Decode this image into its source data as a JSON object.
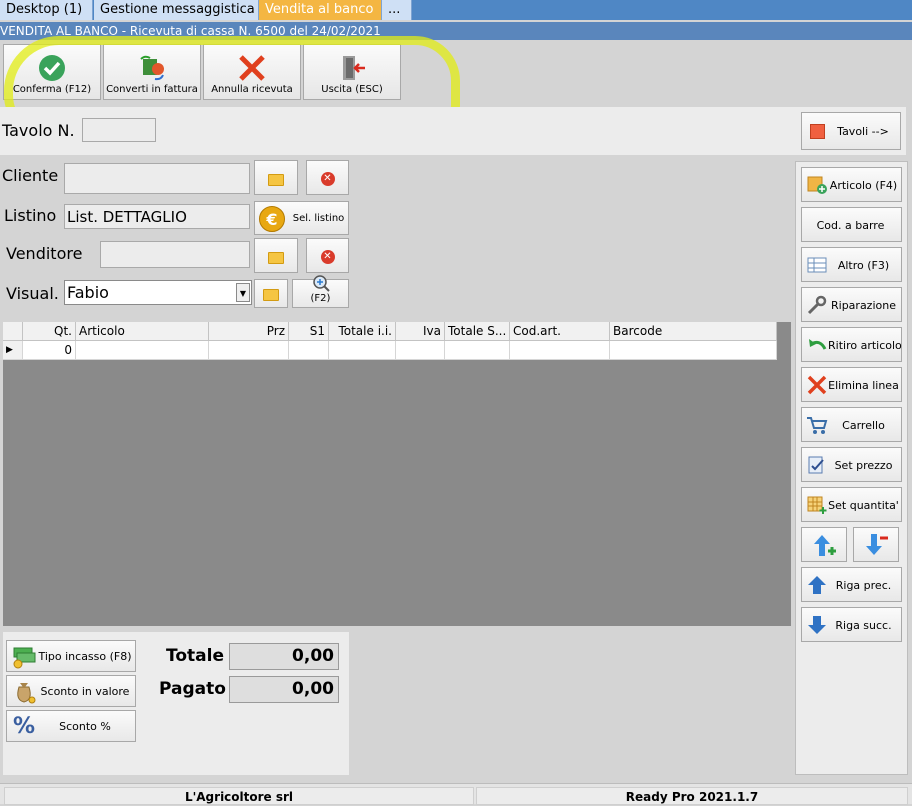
{
  "tabs": [
    {
      "label": "Desktop (1)",
      "active": false
    },
    {
      "label": "Gestione messaggistica",
      "active": false
    },
    {
      "label": "Vendita al banco",
      "active": true
    },
    {
      "label": "...",
      "active": false
    }
  ],
  "window_title": "VENDITA AL BANCO - Ricevuta di cassa N. 6500 del 24/02/2021",
  "toolbar": {
    "confirm_label": "Conferma (F12)",
    "convert_label": "Converti in fattura",
    "cancel_label": "Annulla ricevuta",
    "exit_label": "Uscita (ESC)"
  },
  "tavolo": {
    "label": "Tavolo N.",
    "value": "",
    "button_label": "Tavoli -->"
  },
  "form": {
    "cliente_label": "Cliente",
    "cliente_value": "",
    "listino_label": "Listino",
    "listino_value": "List. DETTAGLIO",
    "sel_listino_label": "Sel. listino",
    "venditore_label": "Venditore",
    "venditore_value": "",
    "visual_label": "Visual.",
    "visual_value": "Fabio",
    "search_shortcut": "(F2)"
  },
  "grid": {
    "columns": [
      "Qt.",
      "Articolo",
      "Prz",
      "S1",
      "Totale i.i.",
      "Iva",
      "Totale S...",
      "Cod.art.",
      "Barcode"
    ],
    "rows": [
      [
        "0",
        "",
        "",
        "",
        "",
        "",
        "",
        "",
        ""
      ]
    ]
  },
  "side_buttons": [
    {
      "label": "Articolo (F4)",
      "icon": "add-article-icon"
    },
    {
      "label": "Cod. a barre",
      "icon": ""
    },
    {
      "label": "Altro (F3)",
      "icon": "other-icon"
    },
    {
      "label": "Riparazione",
      "icon": "wrench-icon"
    },
    {
      "label": "Ritiro articolo",
      "icon": "return-arrow-icon"
    },
    {
      "label": "Elimina linea",
      "icon": "delete-x-icon"
    },
    {
      "label": "Carrello",
      "icon": "cart-icon"
    },
    {
      "label": "Set prezzo",
      "icon": "price-tag-icon"
    },
    {
      "label": "Set quantita'",
      "icon": "quantity-grid-icon"
    },
    {
      "label": "Riga prec.",
      "icon": "arrow-up-icon"
    },
    {
      "label": "Riga succ.",
      "icon": "arrow-down-icon"
    }
  ],
  "bottom": {
    "tipo_incasso_label": "Tipo incasso (F8)",
    "sconto_valore_label": "Sconto in valore",
    "sconto_perc_label": "Sconto %",
    "totale_label": "Totale",
    "totale_value": "0,00",
    "pagato_label": "Pagato",
    "pagato_value": "0,00"
  },
  "status": {
    "company": "L'Agricoltore srl",
    "version": "Ready Pro 2021.1.7"
  },
  "colors": {
    "tab_active": "#f4b642",
    "titlebar": "#5a86bc",
    "highlight": "#e2ec14"
  }
}
